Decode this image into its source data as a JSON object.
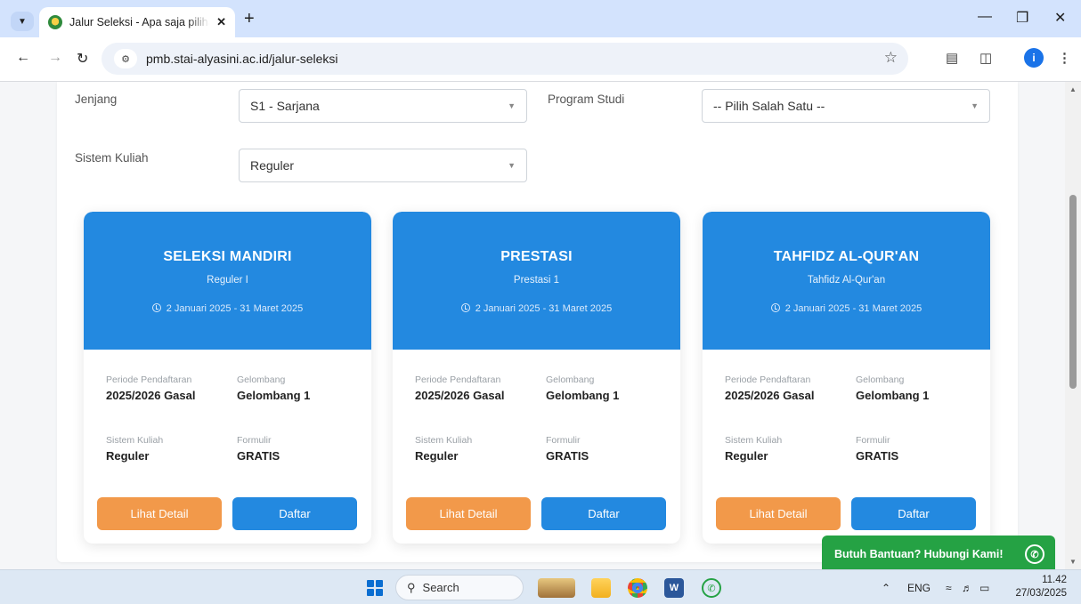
{
  "browser": {
    "tab_title": "Jalur Seleksi - Apa saja pilihan j",
    "url": "pmb.stai-alyasini.ac.id/jalur-seleksi"
  },
  "filters": {
    "jenjang_label": "Jenjang",
    "jenjang_value": "S1 - Sarjana",
    "prodi_label": "Program Studi",
    "prodi_value": "-- Pilih Salah Satu --",
    "sistem_label": "Sistem Kuliah",
    "sistem_value": "Reguler"
  },
  "labels": {
    "periode": "Periode Pendaftaran",
    "gelombang": "Gelombang",
    "sistem": "Sistem Kuliah",
    "formulir": "Formulir",
    "detail_button": "Lihat Detail",
    "daftar_button": "Daftar"
  },
  "cards": [
    {
      "title": "SELEKSI MANDIRI",
      "subtitle": "Reguler I",
      "date_range": "2 Januari 2025 - 31 Maret 2025",
      "periode": "2025/2026 Gasal",
      "gelombang": "Gelombang 1",
      "sistem": "Reguler",
      "formulir": "GRATIS"
    },
    {
      "title": "PRESTASI",
      "subtitle": "Prestasi 1",
      "date_range": "2 Januari 2025 - 31 Maret 2025",
      "periode": "2025/2026 Gasal",
      "gelombang": "Gelombang 1",
      "sistem": "Reguler",
      "formulir": "GRATIS"
    },
    {
      "title": "TAHFIDZ AL-QUR'AN",
      "subtitle": "Tahfidz Al-Qur'an",
      "date_range": "2 Januari 2025 - 31 Maret 2025",
      "periode": "2025/2026 Gasal",
      "gelombang": "Gelombang 1",
      "sistem": "Reguler",
      "formulir": "GRATIS"
    }
  ],
  "help": {
    "label": "Butuh Bantuan? Hubungi Kami!"
  },
  "taskbar": {
    "search": "Search",
    "language": "ENG",
    "time": "11.42",
    "date": "27/03/2025"
  },
  "colors": {
    "card_header": "#2389e0",
    "detail_button": "#f2994a",
    "daftar_button": "#2389e0",
    "help_bar": "#25a244"
  }
}
